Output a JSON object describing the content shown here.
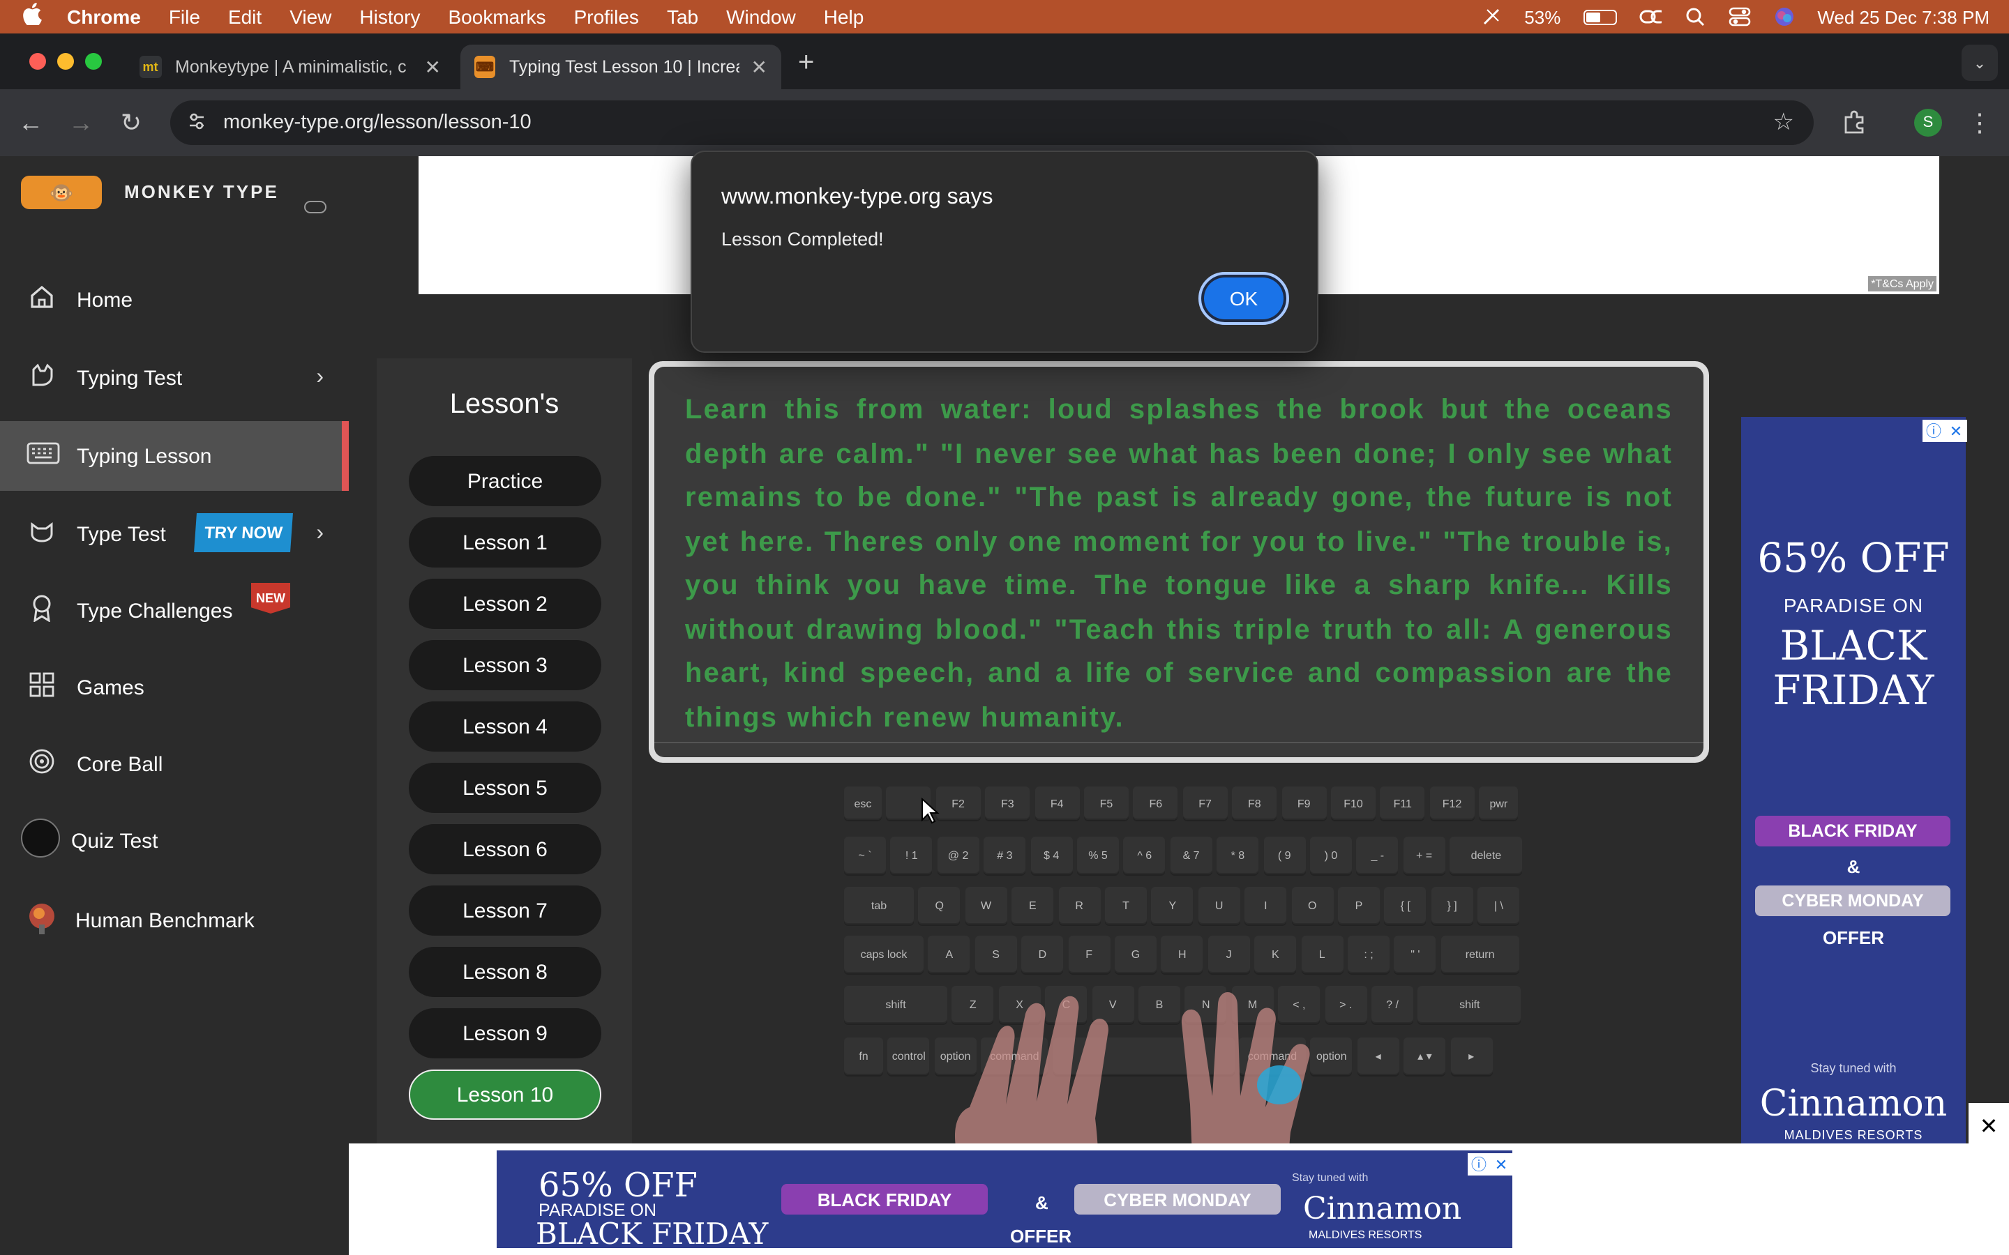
{
  "menubar": {
    "app": "Chrome",
    "items": [
      "File",
      "Edit",
      "View",
      "History",
      "Bookmarks",
      "Profiles",
      "Tab",
      "Window",
      "Help"
    ],
    "battery_pct": "53%",
    "battery_level": 0.53,
    "datetime": "Wed 25 Dec  7:38 PM"
  },
  "browser": {
    "tabs": [
      {
        "title": "Monkeytype | A minimalistic, c",
        "favicon": "mt"
      },
      {
        "title": "Typing Test Lesson 10 | Increa",
        "favicon": "keyboard-icon"
      }
    ],
    "url": "monkey-type.org/lesson/lesson-10",
    "profile_initial": "S"
  },
  "sidebar": {
    "brand": "MONKEY TYPE",
    "items": [
      {
        "label": "Home",
        "icon": "home-icon"
      },
      {
        "label": "Typing Test",
        "icon": "cat-icon"
      },
      {
        "label": "Typing Lesson",
        "icon": "keyboard-icon"
      },
      {
        "label": "Type Test",
        "icon": "cat-face-icon",
        "badge": "TRY NOW"
      },
      {
        "label": "Type Challenges",
        "icon": "medal-icon",
        "badge": "NEW"
      },
      {
        "label": "Games",
        "icon": "grid-icon"
      },
      {
        "label": "Core Ball",
        "icon": "target-icon"
      },
      {
        "label": "Quiz Test",
        "icon": "quiz-avatar-icon"
      },
      {
        "label": "Human Benchmark",
        "icon": "brain-icon"
      }
    ]
  },
  "topad": {
    "tcs": "*T&Cs Apply"
  },
  "lessons": {
    "heading": "Lesson's",
    "items": [
      "Practice",
      "Lesson 1",
      "Lesson 2",
      "Lesson 3",
      "Lesson 4",
      "Lesson 5",
      "Lesson 6",
      "Lesson 7",
      "Lesson 8",
      "Lesson 9",
      "Lesson 10"
    ],
    "active": "Lesson 10"
  },
  "typing_text": "Learn this from water: loud splashes the brook but the oceans depth are calm.\" \"I never see what has been done; I only see what remains to be done.\" \"The past is already gone, the future is not yet here. Theres only one moment for you to live.\" \"The trouble is, you think you have time. The tongue like a sharp knife... Kills without drawing blood.\" \"Teach this triple truth to all: A generous heart, kind speech, and a life of service and compassion are the things which renew humanity.",
  "keyboard": {
    "rows": [
      [
        "esc",
        "",
        "F2",
        "F3",
        "F4",
        "F5",
        "F6",
        "F7",
        "F8",
        "F9",
        "F10",
        "F11",
        "F12",
        "pwr"
      ],
      [
        "~ `",
        "! 1",
        "@ 2",
        "# 3",
        "$ 4",
        "% 5",
        "^ 6",
        "& 7",
        "* 8",
        "( 9",
        ") 0",
        "_ -",
        "+ =",
        "delete"
      ],
      [
        "tab",
        "Q",
        "W",
        "E",
        "R",
        "T",
        "Y",
        "U",
        "I",
        "O",
        "P",
        "{ [",
        "} ]",
        "| \\"
      ],
      [
        "caps lock",
        "A",
        "S",
        "D",
        "F",
        "G",
        "H",
        "J",
        "K",
        "L",
        ": ;",
        "\" '",
        "return"
      ],
      [
        "shift",
        "Z",
        "X",
        "C",
        "V",
        "B",
        "N",
        "M",
        "< ,",
        "> .",
        "? /",
        "shift"
      ],
      [
        "fn",
        "control",
        "option",
        "command",
        "",
        "command",
        "option",
        "◂",
        "▴ ▾",
        "▸"
      ]
    ]
  },
  "right_ad": {
    "line1": "65% OFF",
    "line2": "PARADISE ON",
    "line3": "BLACK FRIDAY",
    "pill1": "BLACK FRIDAY",
    "amp": "&",
    "pill2": "CYBER MONDAY",
    "offer": "OFFER",
    "stay": "Stay tuned with",
    "brand": "Cinnamon",
    "sub": "MALDIVES RESORTS"
  },
  "bottom_ad": {
    "line1": "65% OFF",
    "line2": "PARADISE ON",
    "line3": "BLACK FRIDAY",
    "pill1": "BLACK FRIDAY",
    "amp": "&",
    "pill2": "CYBER MONDAY",
    "offer": "OFFER",
    "stay": "Stay tuned with",
    "brand": "Cinnamon",
    "sub": "MALDIVES RESORTS"
  },
  "dialog": {
    "origin": "www.monkey-type.org says",
    "message": "Lesson Completed!",
    "ok": "OK"
  },
  "colors": {
    "accent_green": "#3d9a4a",
    "ad_blue": "#2d3c8c",
    "active_marker": "#e05555"
  }
}
